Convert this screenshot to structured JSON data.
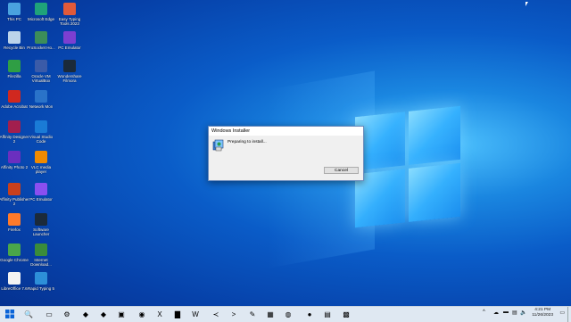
{
  "desktop": {
    "icons": [
      {
        "label": "This PC",
        "icon": "computer-icon",
        "color": "#4aa3df"
      },
      {
        "label": "Microsoft Edge",
        "icon": "edge-icon",
        "color": "#1fa37a"
      },
      {
        "label": "Easy Typing Tools 2023",
        "icon": "typing-icon",
        "color": "#e05a3a"
      },
      {
        "label": "Recycle Bin",
        "icon": "recycle-bin-icon",
        "color": "#bcd4ea"
      },
      {
        "label": "ProSocket Ho...",
        "icon": "app-icon",
        "color": "#3c8d5a"
      },
      {
        "label": "PC Emulator",
        "icon": "emulator-icon",
        "color": "#7b3fd1"
      },
      {
        "label": "Filezilla",
        "icon": "filezilla-icon",
        "color": "#2f9e44"
      },
      {
        "label": "Oracle VM VirtualBox",
        "icon": "virtualbox-icon",
        "color": "#3b5ba8"
      },
      {
        "label": "Wondershare Filmora",
        "icon": "filmora-icon",
        "color": "#1b2a3a"
      },
      {
        "label": "Adobe Acrobat",
        "icon": "acrobat-icon",
        "color": "#d0281f"
      },
      {
        "label": "Network Mon",
        "icon": "network-icon",
        "color": "#2a73c9"
      },
      {
        "label": "Affinity Designer 2",
        "icon": "affinity-designer-icon",
        "color": "#a21f4e"
      },
      {
        "label": "Visual Studio Code",
        "icon": "vscode-icon",
        "color": "#1a7bd6"
      },
      {
        "label": "Affinity Photo 2",
        "icon": "affinity-photo-icon",
        "color": "#6b2fbf"
      },
      {
        "label": "VLC media player",
        "icon": "vlc-icon",
        "color": "#f08a00"
      },
      {
        "label": "Affinity Publisher 2",
        "icon": "affinity-publisher-icon",
        "color": "#c8401c"
      },
      {
        "label": "PC Emulator",
        "icon": "emulator-icon",
        "color": "#8a4ff0"
      },
      {
        "label": "Firefox",
        "icon": "firefox-icon",
        "color": "#ff7a2a"
      },
      {
        "label": "Software Launcher",
        "icon": "launcher-icon",
        "color": "#1b2a3a"
      },
      {
        "label": "Google Chrome",
        "icon": "chrome-icon",
        "color": "#4aa74a"
      },
      {
        "label": "Internet Download...",
        "icon": "download-icon",
        "color": "#3a8c3a"
      },
      {
        "label": "LibreOffice 7.6",
        "icon": "document-icon",
        "color": "#f3f3f3"
      },
      {
        "label": "Rapid Typing 5",
        "icon": "rapid-typing-icon",
        "color": "#2d8fd8"
      }
    ]
  },
  "dialog": {
    "title": "Windows Installer",
    "message": "Preparing to install...",
    "cancel_label": "Cancel"
  },
  "taskbar": {
    "time": "4:21 PM",
    "date": "11/26/2023",
    "tray_chevron": "^",
    "apps": [
      {
        "icon": "search-icon",
        "glyph": "🔍"
      },
      {
        "icon": "task-view-icon",
        "glyph": "▭"
      },
      {
        "icon": "settings-icon",
        "glyph": "⚙"
      },
      {
        "icon": "affinity-photo-icon",
        "glyph": "◆"
      },
      {
        "icon": "affinity-designer-icon",
        "glyph": "◆"
      },
      {
        "icon": "photo-icon",
        "glyph": "▣"
      },
      {
        "icon": "chrome-icon",
        "glyph": "◉"
      },
      {
        "icon": "excel-icon",
        "glyph": "X"
      },
      {
        "icon": "file-explorer-icon",
        "glyph": "▇"
      },
      {
        "icon": "word-icon",
        "glyph": "W"
      },
      {
        "icon": "vscode-icon",
        "glyph": "≺"
      },
      {
        "icon": "terminal-icon",
        "glyph": ">"
      },
      {
        "icon": "inkscape-icon",
        "glyph": "✎"
      },
      {
        "icon": "settings-app-icon",
        "glyph": "▦"
      },
      {
        "icon": "browser-icon",
        "glyph": "◍"
      },
      {
        "icon": "firefox-icon",
        "glyph": "●"
      },
      {
        "icon": "document-icon",
        "glyph": "▤"
      },
      {
        "icon": "installer-icon",
        "glyph": "▩"
      }
    ],
    "tray": [
      {
        "icon": "chevron-up-icon",
        "glyph": "^"
      },
      {
        "icon": "cloud-icon",
        "glyph": "☁"
      },
      {
        "icon": "battery-icon",
        "glyph": "▬"
      },
      {
        "icon": "network-icon",
        "glyph": "▤"
      },
      {
        "icon": "volume-icon",
        "glyph": "🔈"
      }
    ]
  }
}
